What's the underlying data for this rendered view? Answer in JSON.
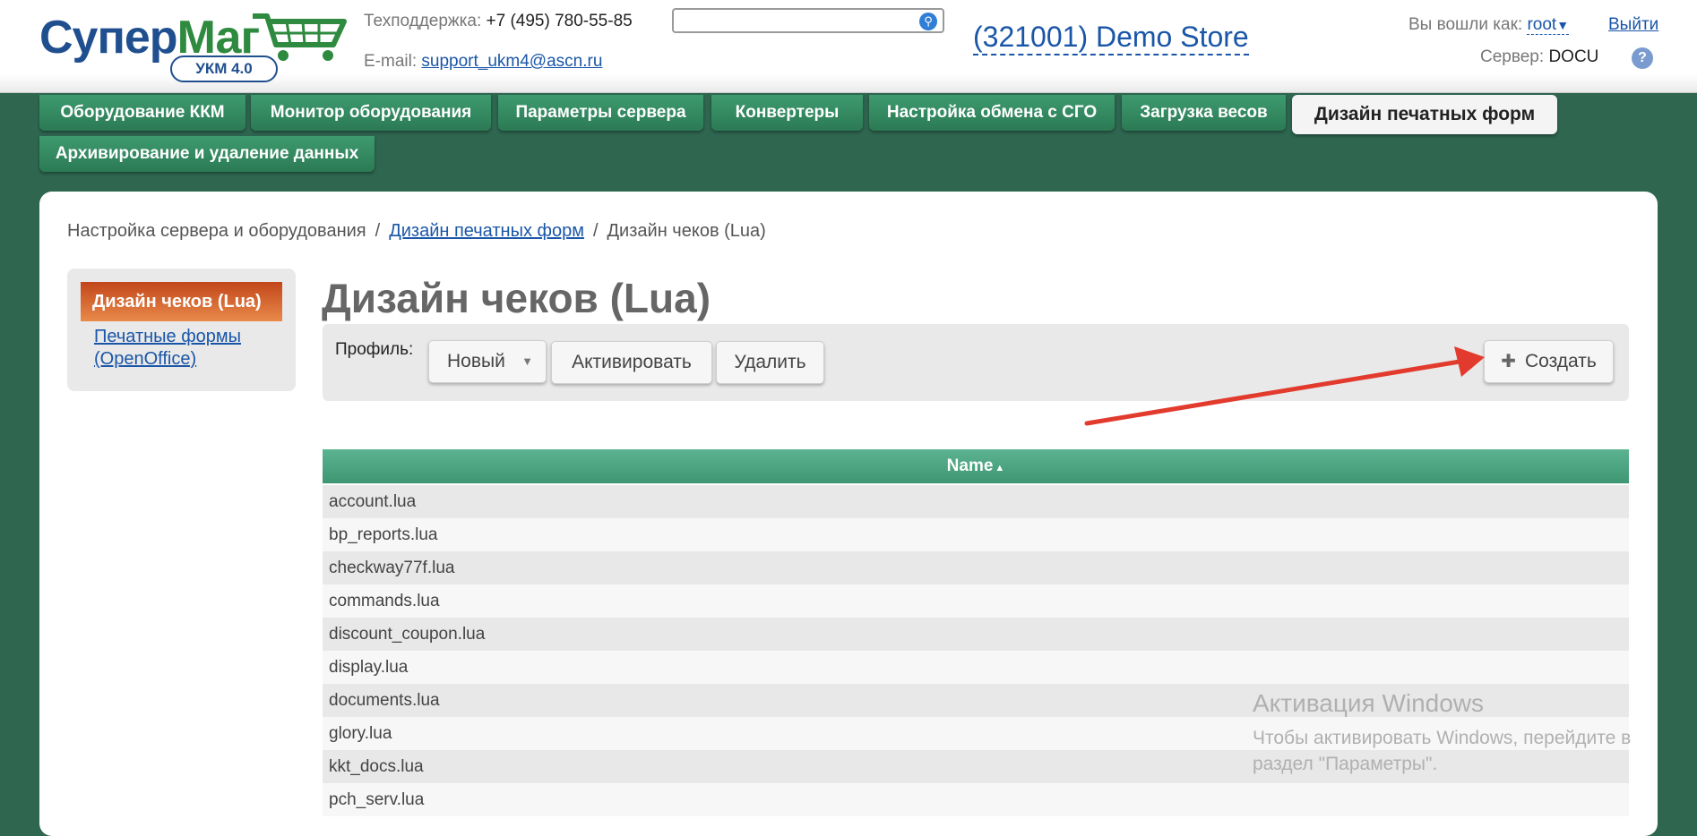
{
  "header": {
    "logo_main": "Супер",
    "logo_accent": "Маг",
    "logo_badge": "УКМ 4.0",
    "support_label": "Техподдержка:",
    "support_phone": "+7 (495) 780-55-85",
    "email_label": "E-mail:",
    "email_value": "support_ukm4@ascn.ru",
    "search_value": "",
    "store_name": "(321001) Demo Store",
    "logged_as_label": "Вы вошли как:",
    "user_name": "root",
    "logout_label": "Выйти",
    "server_label": "Сервер:",
    "server_name": "DOCU"
  },
  "tabs": [
    "Оборудование ККМ",
    "Монитор оборудования",
    "Параметры сервера",
    "Конвертеры",
    "Настройка обмена с СГО",
    "Загрузка весов",
    "Дизайн печатных форм",
    "Архивирование и удаление данных"
  ],
  "breadcrumb": {
    "root": "Настройка сервера и оборудования",
    "middle": "Дизайн печатных форм",
    "current": "Дизайн чеков (Lua)",
    "separator": "/"
  },
  "sidebar": {
    "active": "Дизайн чеков (Lua)",
    "link": "Печатные формы (OpenOffice)"
  },
  "page_title": "Дизайн чеков (Lua)",
  "toolbar": {
    "profile_label": "Профиль:",
    "profile_value": "Новый",
    "activate_label": "Активировать",
    "delete_label": "Удалить",
    "create_label": "Создать"
  },
  "table": {
    "column": "Name",
    "sort_indicator": "▲",
    "rows": [
      "account.lua",
      "bp_reports.lua",
      "checkway77f.lua",
      "commands.lua",
      "discount_coupon.lua",
      "display.lua",
      "documents.lua",
      "glory.lua",
      "kkt_docs.lua",
      "pch_serv.lua"
    ]
  },
  "watermark": {
    "title": "Активация Windows",
    "text": "Чтобы активировать Windows, перейдите в раздел \"Параметры\"."
  },
  "colors": {
    "background": "#2e6650",
    "tab": "#3e9a6e",
    "sidebar_active": "#d9692f",
    "link": "#1a56a8",
    "annotation_arrow": "#e23b2e"
  }
}
